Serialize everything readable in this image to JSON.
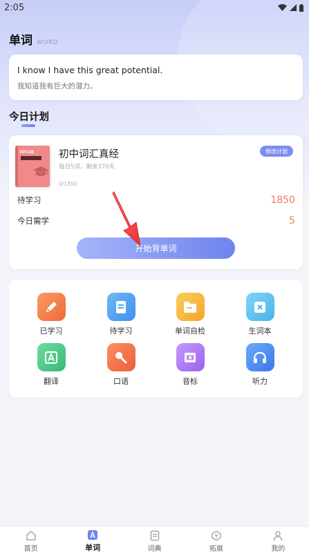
{
  "status_bar": {
    "time": "2:05"
  },
  "header": {
    "title": "单词",
    "subtitle": "WORD"
  },
  "quote": {
    "english": "I know I have this great potential.",
    "chinese": "我知道我有巨大的潜力。"
  },
  "plan": {
    "section_title": "今日计划",
    "book": {
      "name": "初中词汇真经",
      "meta": "每日5词，剩余370天",
      "progress": "0/1850",
      "cover_title": "VOCAB",
      "cover_color": "#f08a8a"
    },
    "edit_button": "修改计划",
    "stats": [
      {
        "label": "待学习",
        "value": "1850"
      },
      {
        "label": "今日需学",
        "value": "5"
      }
    ],
    "start_button": "开始背单词"
  },
  "grid": [
    {
      "label": "已学习",
      "icon": "pencil-icon",
      "color": "#f47a4a"
    },
    {
      "label": "待学习",
      "icon": "document-icon",
      "color": "#4ea3f5"
    },
    {
      "label": "单词自检",
      "icon": "folder-icon",
      "color": "#f7b73a"
    },
    {
      "label": "生词本",
      "icon": "close-box-icon",
      "color": "#5fc4f0"
    },
    {
      "label": "翻译",
      "icon": "translate-icon",
      "color": "#4ecb8a"
    },
    {
      "label": "口语",
      "icon": "microphone-icon",
      "color": "#f4734e"
    },
    {
      "label": "音标",
      "icon": "phonetic-icon",
      "color": "#b07bf2"
    },
    {
      "label": "听力",
      "icon": "headphones-icon",
      "color": "#4f8ef5"
    }
  ],
  "tabs": [
    {
      "label": "首页",
      "icon": "home-icon",
      "active": false
    },
    {
      "label": "单词",
      "icon": "word-icon",
      "active": true
    },
    {
      "label": "词典",
      "icon": "dictionary-icon",
      "active": false
    },
    {
      "label": "拓展",
      "icon": "expand-icon",
      "active": false
    },
    {
      "label": "我的",
      "icon": "profile-icon",
      "active": false
    }
  ],
  "colors": {
    "accent": "#6f84ef",
    "stat_value": "#f07a5c"
  }
}
